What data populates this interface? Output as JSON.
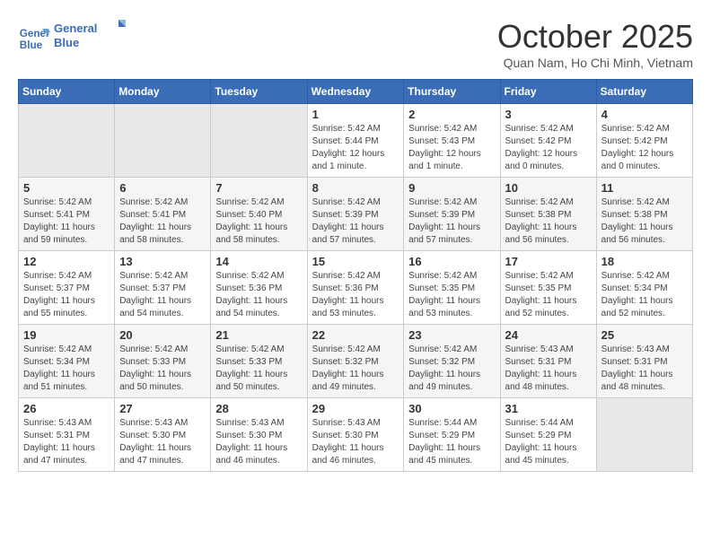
{
  "logo": {
    "line1": "General",
    "line2": "Blue"
  },
  "title": "October 2025",
  "subtitle": "Quan Nam, Ho Chi Minh, Vietnam",
  "weekdays": [
    "Sunday",
    "Monday",
    "Tuesday",
    "Wednesday",
    "Thursday",
    "Friday",
    "Saturday"
  ],
  "weeks": [
    [
      {
        "day": "",
        "info": ""
      },
      {
        "day": "",
        "info": ""
      },
      {
        "day": "",
        "info": ""
      },
      {
        "day": "1",
        "info": "Sunrise: 5:42 AM\nSunset: 5:44 PM\nDaylight: 12 hours\nand 1 minute."
      },
      {
        "day": "2",
        "info": "Sunrise: 5:42 AM\nSunset: 5:43 PM\nDaylight: 12 hours\nand 1 minute."
      },
      {
        "day": "3",
        "info": "Sunrise: 5:42 AM\nSunset: 5:42 PM\nDaylight: 12 hours\nand 0 minutes."
      },
      {
        "day": "4",
        "info": "Sunrise: 5:42 AM\nSunset: 5:42 PM\nDaylight: 12 hours\nand 0 minutes."
      }
    ],
    [
      {
        "day": "5",
        "info": "Sunrise: 5:42 AM\nSunset: 5:41 PM\nDaylight: 11 hours\nand 59 minutes."
      },
      {
        "day": "6",
        "info": "Sunrise: 5:42 AM\nSunset: 5:41 PM\nDaylight: 11 hours\nand 58 minutes."
      },
      {
        "day": "7",
        "info": "Sunrise: 5:42 AM\nSunset: 5:40 PM\nDaylight: 11 hours\nand 58 minutes."
      },
      {
        "day": "8",
        "info": "Sunrise: 5:42 AM\nSunset: 5:39 PM\nDaylight: 11 hours\nand 57 minutes."
      },
      {
        "day": "9",
        "info": "Sunrise: 5:42 AM\nSunset: 5:39 PM\nDaylight: 11 hours\nand 57 minutes."
      },
      {
        "day": "10",
        "info": "Sunrise: 5:42 AM\nSunset: 5:38 PM\nDaylight: 11 hours\nand 56 minutes."
      },
      {
        "day": "11",
        "info": "Sunrise: 5:42 AM\nSunset: 5:38 PM\nDaylight: 11 hours\nand 56 minutes."
      }
    ],
    [
      {
        "day": "12",
        "info": "Sunrise: 5:42 AM\nSunset: 5:37 PM\nDaylight: 11 hours\nand 55 minutes."
      },
      {
        "day": "13",
        "info": "Sunrise: 5:42 AM\nSunset: 5:37 PM\nDaylight: 11 hours\nand 54 minutes."
      },
      {
        "day": "14",
        "info": "Sunrise: 5:42 AM\nSunset: 5:36 PM\nDaylight: 11 hours\nand 54 minutes."
      },
      {
        "day": "15",
        "info": "Sunrise: 5:42 AM\nSunset: 5:36 PM\nDaylight: 11 hours\nand 53 minutes."
      },
      {
        "day": "16",
        "info": "Sunrise: 5:42 AM\nSunset: 5:35 PM\nDaylight: 11 hours\nand 53 minutes."
      },
      {
        "day": "17",
        "info": "Sunrise: 5:42 AM\nSunset: 5:35 PM\nDaylight: 11 hours\nand 52 minutes."
      },
      {
        "day": "18",
        "info": "Sunrise: 5:42 AM\nSunset: 5:34 PM\nDaylight: 11 hours\nand 52 minutes."
      }
    ],
    [
      {
        "day": "19",
        "info": "Sunrise: 5:42 AM\nSunset: 5:34 PM\nDaylight: 11 hours\nand 51 minutes."
      },
      {
        "day": "20",
        "info": "Sunrise: 5:42 AM\nSunset: 5:33 PM\nDaylight: 11 hours\nand 50 minutes."
      },
      {
        "day": "21",
        "info": "Sunrise: 5:42 AM\nSunset: 5:33 PM\nDaylight: 11 hours\nand 50 minutes."
      },
      {
        "day": "22",
        "info": "Sunrise: 5:42 AM\nSunset: 5:32 PM\nDaylight: 11 hours\nand 49 minutes."
      },
      {
        "day": "23",
        "info": "Sunrise: 5:42 AM\nSunset: 5:32 PM\nDaylight: 11 hours\nand 49 minutes."
      },
      {
        "day": "24",
        "info": "Sunrise: 5:43 AM\nSunset: 5:31 PM\nDaylight: 11 hours\nand 48 minutes."
      },
      {
        "day": "25",
        "info": "Sunrise: 5:43 AM\nSunset: 5:31 PM\nDaylight: 11 hours\nand 48 minutes."
      }
    ],
    [
      {
        "day": "26",
        "info": "Sunrise: 5:43 AM\nSunset: 5:31 PM\nDaylight: 11 hours\nand 47 minutes."
      },
      {
        "day": "27",
        "info": "Sunrise: 5:43 AM\nSunset: 5:30 PM\nDaylight: 11 hours\nand 47 minutes."
      },
      {
        "day": "28",
        "info": "Sunrise: 5:43 AM\nSunset: 5:30 PM\nDaylight: 11 hours\nand 46 minutes."
      },
      {
        "day": "29",
        "info": "Sunrise: 5:43 AM\nSunset: 5:30 PM\nDaylight: 11 hours\nand 46 minutes."
      },
      {
        "day": "30",
        "info": "Sunrise: 5:44 AM\nSunset: 5:29 PM\nDaylight: 11 hours\nand 45 minutes."
      },
      {
        "day": "31",
        "info": "Sunrise: 5:44 AM\nSunset: 5:29 PM\nDaylight: 11 hours\nand 45 minutes."
      },
      {
        "day": "",
        "info": ""
      }
    ]
  ]
}
